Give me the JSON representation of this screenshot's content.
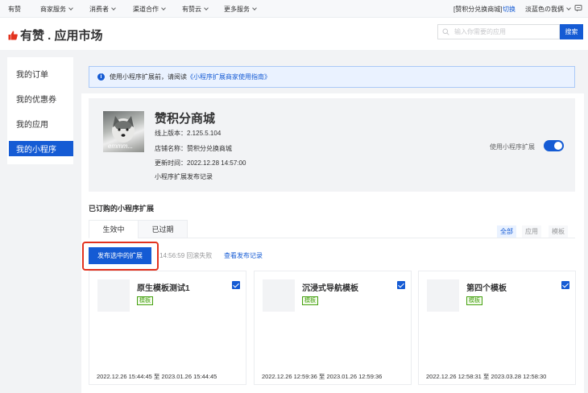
{
  "topnav": {
    "home": "有赞",
    "menus": [
      "商家服务",
      "消费者",
      "渠道合作",
      "有赞云",
      "更多服务"
    ],
    "shop_name": "[赞积分兑换商城]",
    "switch_label": "切换",
    "user_name": "淡蓝色の我俩"
  },
  "header": {
    "logo_text": "有赞 . 应用市场",
    "search_placeholder": "输入你需要的应用",
    "search_button": "搜索"
  },
  "sidebar": {
    "items": [
      {
        "label": "我的订单"
      },
      {
        "label": "我的优惠券"
      },
      {
        "label": "我的应用"
      },
      {
        "label": "我的小程序"
      }
    ]
  },
  "notice": {
    "prefix": "使用小程序扩展前，请阅读",
    "link": "《小程序扩展商家使用指南》"
  },
  "app": {
    "avatar_caption": "emmm...",
    "title": "赞积分商城",
    "version_label": "线上版本：",
    "version_value": "2.125.5.104",
    "store_label": "店铺名称：",
    "store_value": "赞积分兑换商城",
    "updated_label": "更新时间：",
    "updated_value": "2022.12.28 14:57:00",
    "publish_records_link": "小程序扩展发布记录",
    "toggle_label": "使用小程序扩展",
    "toggle_on": true
  },
  "extensions_section": {
    "title": "已订购的小程序扩展",
    "tabs": [
      "生效中",
      "已过期"
    ],
    "filters": [
      "全部",
      "应用",
      "模板"
    ],
    "publish_button": "发布选中的扩展",
    "rollback_status": "14:56:59 回滚失败",
    "view_records_link": "查看发布记录",
    "cards": [
      {
        "name": "原生模板测试1",
        "tag": "模板",
        "checked": true,
        "date_range": "2022.12.26 15:44:45 至 2023.01.26 15:44:45"
      },
      {
        "name": "沉浸式导航模板",
        "tag": "模板",
        "checked": true,
        "date_range": "2022.12.26 12:59:36 至 2023.01.26 12:59:36"
      },
      {
        "name": "第四个模板",
        "tag": "模板",
        "checked": true,
        "date_range": "2022.12.26 12:58:31 至 2023.03.28 12:58:30"
      }
    ]
  },
  "colors": {
    "primary": "#155bd4",
    "highlight": "#e3321e",
    "tag_green": "#45a110"
  }
}
